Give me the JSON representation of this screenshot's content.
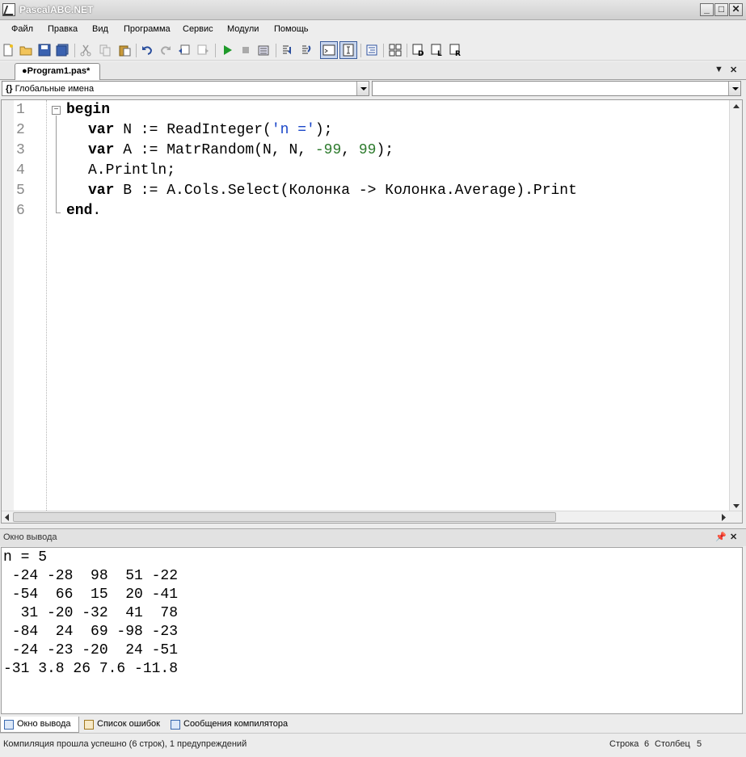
{
  "window": {
    "title": "PascalABC.NET"
  },
  "menu": [
    "Файл",
    "Правка",
    "Вид",
    "Программа",
    "Сервис",
    "Модули",
    "Помощь"
  ],
  "editor_tab": {
    "label": "●Program1.pas*"
  },
  "nav": {
    "scope_combo": "Глобальные имена",
    "member_combo": ""
  },
  "code": {
    "line_numbers": [
      "1",
      "2",
      "3",
      "4",
      "5",
      "6"
    ],
    "l1": {
      "kw": "begin"
    },
    "l2": {
      "kw": "var",
      "a": " N := ReadInteger(",
      "s": "'n ='",
      "b": ");"
    },
    "l3": {
      "kw": "var",
      "a": " A := MatrRandom(N, N, ",
      "n1": "-99",
      "b": ", ",
      "n2": "99",
      "c": ");"
    },
    "l4": {
      "a": "A.Println;"
    },
    "l5": {
      "kw": "var",
      "a": " B := A.Cols.Select(Колонка -> Колонка.Average).Print"
    },
    "l6": {
      "kw": "end",
      "a": "."
    }
  },
  "output": {
    "title": "Окно вывода",
    "lines": [
      "n = 5",
      " -24 -28  98  51 -22",
      " -54  66  15  20 -41",
      "  31 -20 -32  41  78",
      " -84  24  69 -98 -23",
      " -24 -23 -20  24 -51",
      "-31 3.8 26 7.6 -11.8"
    ]
  },
  "bottom_tabs": [
    "Окно вывода",
    "Список ошибок",
    "Сообщения компилятора"
  ],
  "status": {
    "message": "Компиляция прошла успешно (6 строк), 1 предупреждений",
    "row_label": "Строка",
    "row_value": "6",
    "col_label": "Столбец",
    "col_value": "5"
  }
}
